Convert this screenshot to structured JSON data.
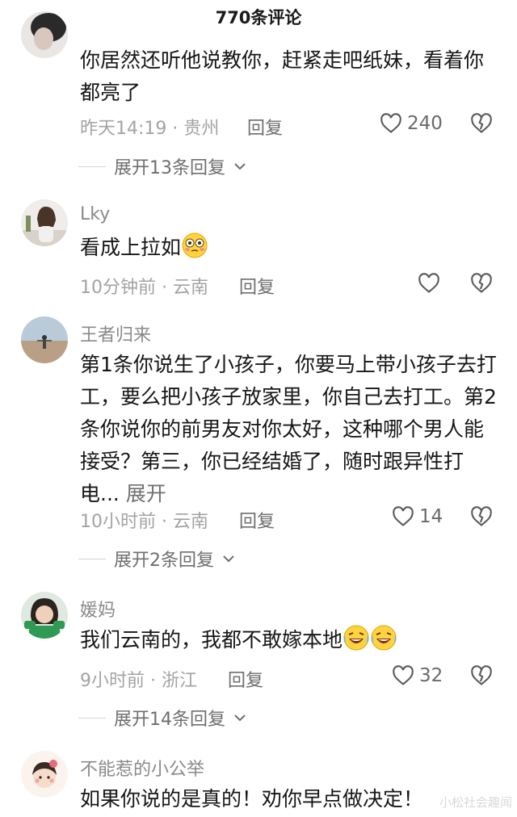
{
  "header": {
    "title": "770条评论"
  },
  "comments": [
    {
      "text": "你居然还听他说教你，赶紧走吧纸妹，看着你都亮了",
      "time": "昨天14:19 · 贵州",
      "reply_label": "回复",
      "likes": "240",
      "replies_label": "展开13条回复"
    },
    {
      "username": "Lky",
      "text": "看成上拉如",
      "emoji": "flushed-emoji",
      "time": "10分钟前 · 云南",
      "reply_label": "回复"
    },
    {
      "username": "王者归来",
      "text": "第1条你说生了小孩子，你要马上带小孩子去打工，要么把小孩子放家里，你自己去打工。第2条你说你的前男友对你太好，这种哪个男人能接受？第三，你已经结婚了，随时跟异性打电...",
      "expand_label": "展开",
      "time": "10小时前 · 云南",
      "reply_label": "回复",
      "likes": "14",
      "replies_label": "展开2条回复"
    },
    {
      "username": "媛妈",
      "text": "我们云南的，我都不敢嫁本地",
      "emoji": "laughing-crying-emoji",
      "time": "9小时前 · 浙江",
      "reply_label": "回复",
      "likes": "32",
      "replies_label": "展开14条回复"
    },
    {
      "username": "不能惹的小公举",
      "text": "如果你说的是真的！劝你早点做决定！"
    }
  ],
  "watermark": "小松社会趣闻",
  "icons": {
    "like": "heart-outline-icon",
    "dislike": "broken-heart-icon",
    "chevron": "chevron-down-icon"
  }
}
